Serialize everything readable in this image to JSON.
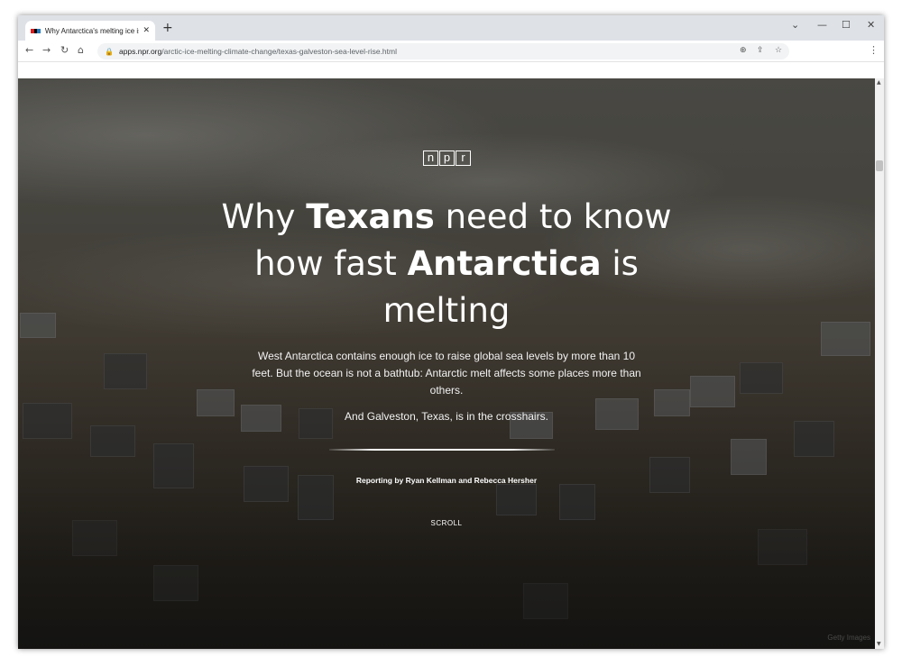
{
  "browser": {
    "tab_title": "Why Antarctica's melting ice is a...",
    "tab_close": "✕",
    "new_tab": "+",
    "url_host": "apps.npr.org",
    "url_path": "/arctic-ice-melting-climate-change/texas-galveston-sea-level-rise.html",
    "favicon_colors": [
      "#d62021",
      "#000000",
      "#237bbd"
    ]
  },
  "article": {
    "logo": [
      "n",
      "p",
      "r"
    ],
    "headline": {
      "part1": "Why ",
      "bold1": "Texans",
      "part2": " need to know how fast ",
      "bold2": "Antarctica",
      "part3": " is melting"
    },
    "dek": "West Antarctica contains enough ice to raise global sea levels by more than 10 feet. But the ocean is not a bathtub: Antarctic melt affects some places more than others.",
    "dek2": "And Galveston, Texas, is in the crosshairs.",
    "byline": "Reporting by Ryan Kellman and Rebecca Hersher",
    "scroll_label": "SCROLL",
    "photo_credit": "Getty Images"
  }
}
